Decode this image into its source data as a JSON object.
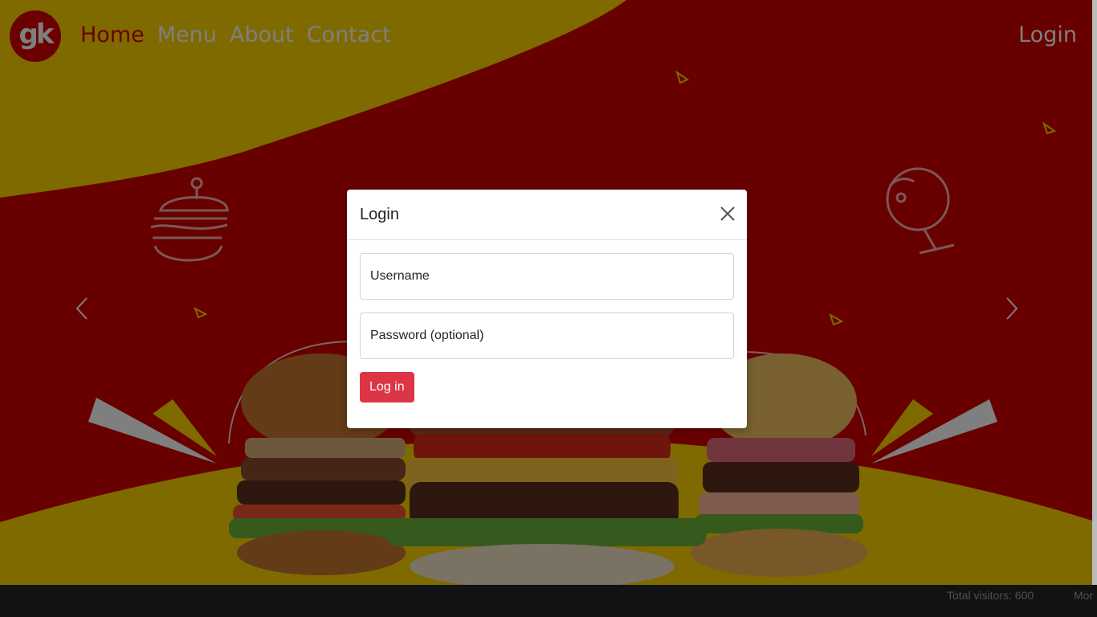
{
  "nav": {
    "logo_text": "gk",
    "links": [
      {
        "label": "Home",
        "active": true
      },
      {
        "label": "Menu",
        "active": false
      },
      {
        "label": "About",
        "active": false
      },
      {
        "label": "Contact",
        "active": false
      }
    ],
    "login_label": "Login"
  },
  "modal": {
    "title": "Login",
    "username_placeholder": "Username",
    "password_placeholder": "Password (optional)",
    "submit_label": "Log in"
  },
  "footer": {
    "visitors_text": "Total visitors: 600",
    "more_text": "Mor"
  },
  "colors": {
    "brand_red": "#d10000",
    "accent_yellow": "#ffd400",
    "button_red": "#dc3545",
    "footer_bg": "#212529"
  },
  "icons": [
    "burger-icon",
    "wine-glass-icon",
    "chevron-left-icon",
    "chevron-right-icon",
    "close-icon"
  ]
}
